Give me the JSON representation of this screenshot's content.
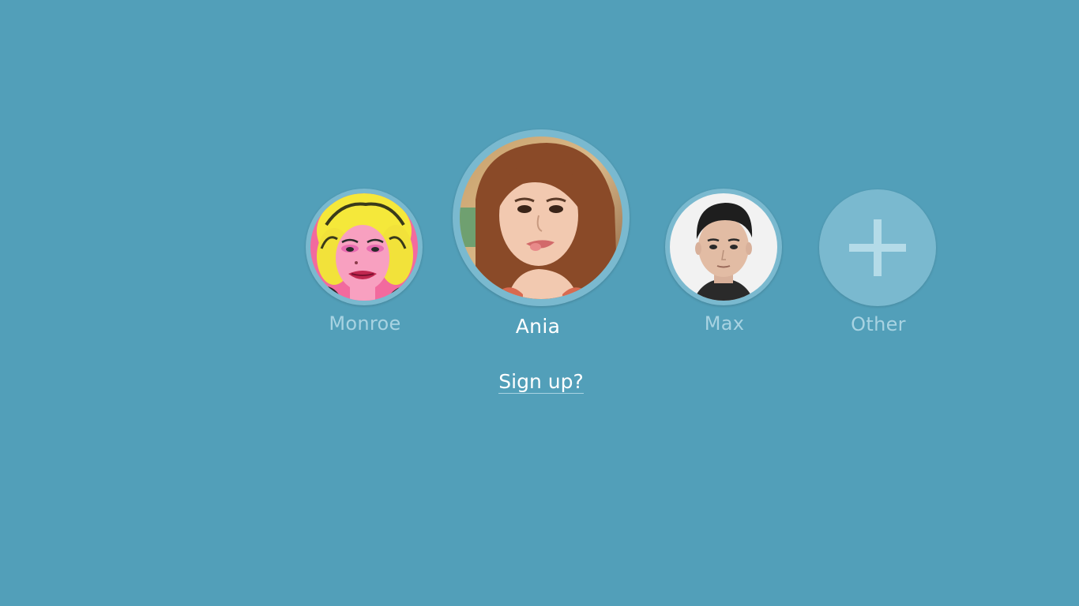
{
  "background_color": "#529fb9",
  "users": [
    {
      "name": "Monroe",
      "avatar_icon": "popart-portrait-photo"
    },
    {
      "name": "Ania",
      "avatar_icon": "woman-portrait-photo",
      "selected": true
    },
    {
      "name": "Max",
      "avatar_icon": "man-portrait-photo"
    },
    {
      "name": "Other",
      "avatar_icon": "plus-icon"
    }
  ],
  "signup": {
    "label": "Sign up?"
  },
  "colors": {
    "selected_name": "#ffffff",
    "inactive_name": "#a8d3e2",
    "avatar_ring": "#7ab9cf"
  }
}
